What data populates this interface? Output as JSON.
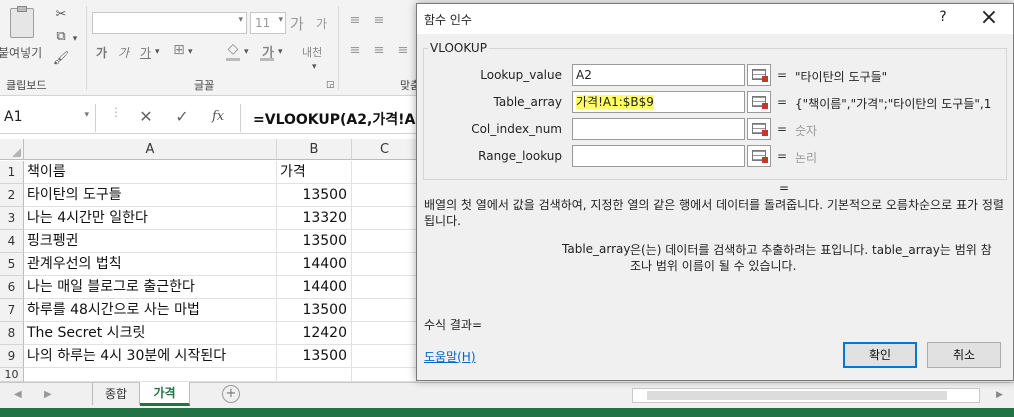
{
  "ribbon": {
    "paste_label": "붙여넣기",
    "clipboard_group": "클립보드",
    "font_group": "글꼴",
    "align_group_partial": "맞춤",
    "font_size": "11",
    "grow_font": "가",
    "shrink_font": "가",
    "bold": "가",
    "italic": "가",
    "underline": "가",
    "font_color_btn": "가",
    "phonetic_btn": "내천"
  },
  "formula_bar": {
    "name_box": "A1",
    "fx": "fx",
    "formula": "=VLOOKUP(A2,가격!A1"
  },
  "grid": {
    "columns": [
      "A",
      "B",
      "C"
    ],
    "rows": [
      {
        "num": "1",
        "a": "책이름",
        "b": "가격"
      },
      {
        "num": "2",
        "a": "타이탄의 도구들",
        "b": "13500"
      },
      {
        "num": "3",
        "a": "나는 4시간만 일한다",
        "b": "13320"
      },
      {
        "num": "4",
        "a": "핑크펭귄",
        "b": "13500"
      },
      {
        "num": "5",
        "a": "관계우선의 법칙",
        "b": "14400"
      },
      {
        "num": "6",
        "a": "나는 매일 블로그로 출근한다",
        "b": "14400"
      },
      {
        "num": "7",
        "a": "하루를 48시간으로 사는 마법",
        "b": "13500"
      },
      {
        "num": "8",
        "a": "The Secret 시크릿",
        "b": "12420"
      },
      {
        "num": "9",
        "a": "나의 하루는 4시 30분에 시작된다",
        "b": "13500"
      },
      {
        "num": "10",
        "a": "",
        "b": ""
      }
    ]
  },
  "sheet_tabs": {
    "tabs": [
      "종합",
      "가격"
    ],
    "active": "가격"
  },
  "dialog": {
    "title": "함수 인수",
    "help_q": "?",
    "close": "×",
    "function_name": "VLOOKUP",
    "args": [
      {
        "label": "Lookup_value",
        "value": "A2",
        "result": "\"타이탄의 도구들\""
      },
      {
        "label": "Table_array",
        "value": "가격!A1:$B$9",
        "result": "{\"책이름\",\"가격\";\"타이탄의 도구들\",1"
      },
      {
        "label": "Col_index_num",
        "value": "",
        "result": "숫자"
      },
      {
        "label": "Range_lookup",
        "value": "",
        "result": "논리"
      }
    ],
    "eq": "=",
    "description": "배열의 첫 열에서 값을 검색하여, 지정한 열의 같은 행에서 데이터를 돌려줍니다. 기본적으로 오름차순으로 표가 정렬됩니다.",
    "param_name": "Table_array",
    "param_desc": "은(는) 데이터를 검색하고 추출하려는 표입니다. table_array는 범위 참조나 범위 이름이 될 수 있습니다.",
    "formula_result": "수식 결과=",
    "help_link": "도움말(H)",
    "ok": "확인",
    "cancel": "취소"
  },
  "colors": {
    "highlight": "#ffff66",
    "active_tab_text": "#217346",
    "statusbar": "#217346",
    "link": "#0066cc"
  }
}
